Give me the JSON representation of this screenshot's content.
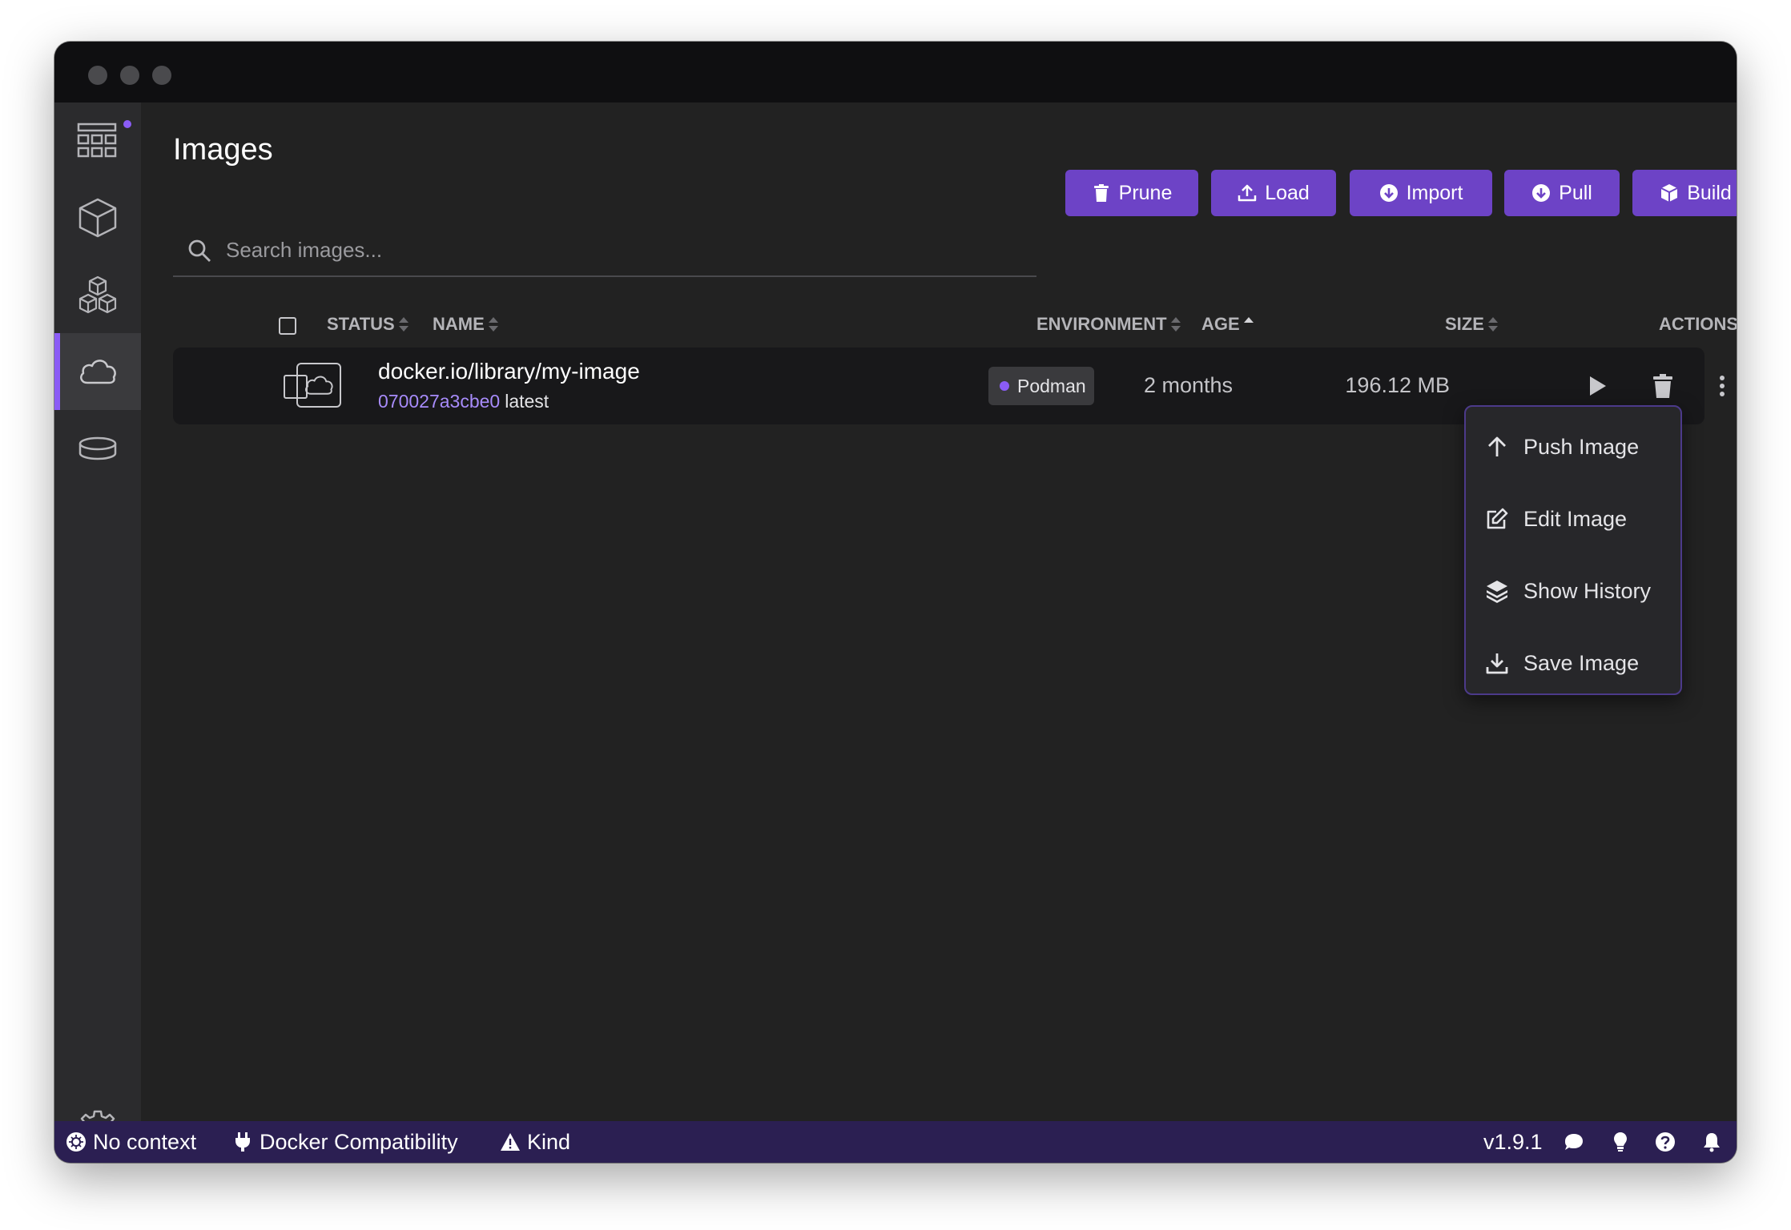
{
  "page": {
    "title": "Images"
  },
  "toolbar": {
    "prune": "Prune",
    "load": "Load",
    "import": "Import",
    "pull": "Pull",
    "build": "Build"
  },
  "search": {
    "placeholder": "Search images..."
  },
  "table": {
    "headers": {
      "status": "STATUS",
      "name": "NAME",
      "environment": "ENVIRONMENT",
      "age": "AGE",
      "size": "SIZE",
      "actions": "ACTIONS"
    },
    "rows": [
      {
        "name": "docker.io/library/my-image",
        "id": "070027a3cbe0",
        "tag": "latest",
        "environment": "Podman",
        "age": "2 months",
        "size": "196.12 MB"
      }
    ]
  },
  "context_menu": {
    "items": [
      {
        "label": "Push Image",
        "icon": "arrow-up-icon"
      },
      {
        "label": "Edit Image",
        "icon": "edit-icon"
      },
      {
        "label": "Show History",
        "icon": "layers-icon"
      },
      {
        "label": "Save Image",
        "icon": "download-icon"
      }
    ]
  },
  "statusbar": {
    "context": "No context",
    "compat": "Docker Compatibility",
    "kind": "Kind",
    "version": "v1.9.1"
  },
  "colors": {
    "accent": "#6d43c6",
    "accent_light": "#a78bfa",
    "statusbar": "#2b1f52",
    "background": "#222222",
    "sidebar": "#2b2b2d"
  }
}
